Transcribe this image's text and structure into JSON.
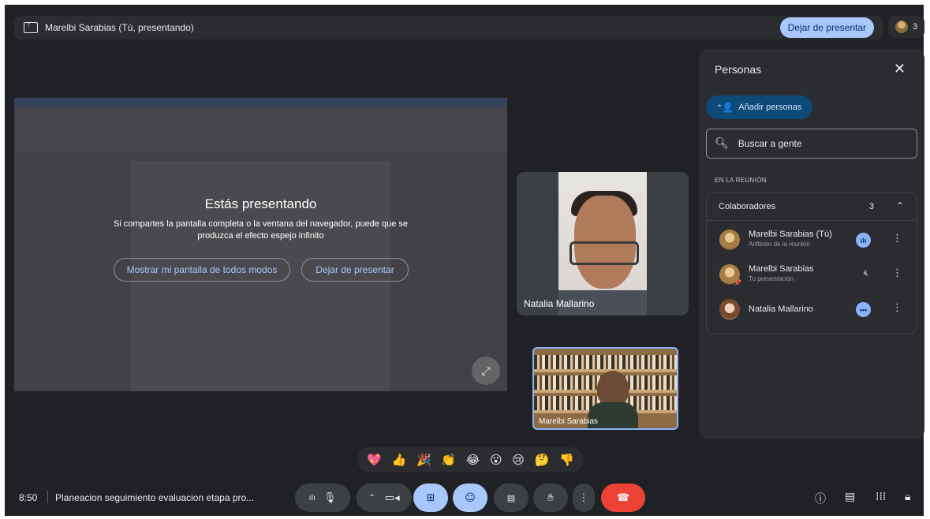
{
  "topbar": {
    "title": "Marelbi Sarabias (Tú, presentando)",
    "stop_label": "Dejar de presentar",
    "people_count": "3"
  },
  "presentation": {
    "heading": "Estás presentando",
    "message": "Si compartes la pantalla completa o la ventana del navegador, puede que se produzca el efecto espejo infinito",
    "show_anyway_label": "Mostrar mi pantalla de todos modos",
    "stop_label": "Dejar de presentar"
  },
  "tiles": {
    "natalia": "Natalia Mallarino",
    "marelbi": "Marelbi Sarabias"
  },
  "panel": {
    "title": "Personas",
    "add_label": "Añadir personas",
    "search_placeholder": "Buscar a gente",
    "section": "EN LA REUNIÓN",
    "group_title": "Colaboradores",
    "group_count": "3",
    "people": [
      {
        "name": "Marelbi Sarabias (Tú)",
        "sub": "Anfitrión de la reunión"
      },
      {
        "name": "Marelbi Sarabias",
        "sub": "Tu presentación"
      },
      {
        "name": "Natalia Mallarino",
        "sub": ""
      }
    ]
  },
  "reactions": [
    "💖",
    "👍",
    "🎉",
    "👏",
    "😂",
    "😮",
    "😢",
    "🤔",
    "👎"
  ],
  "bottom": {
    "time": "8:50",
    "meeting_title": "Planeacion seguimiento evaluacion etapa pro..."
  },
  "colors": {
    "background": "#202124",
    "accent": "#a8c7fa",
    "end_call": "#ea4335"
  }
}
